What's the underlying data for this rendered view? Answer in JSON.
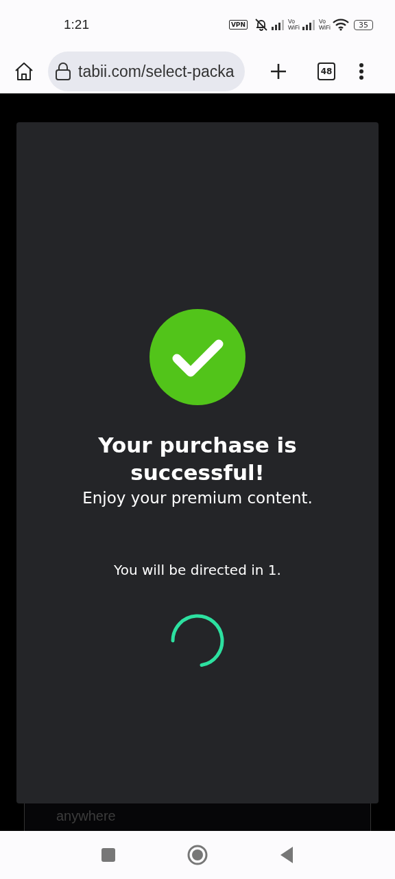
{
  "status_bar": {
    "time": "1:21",
    "vpn": "VPN",
    "vowifi": [
      "Vo\nWiFi",
      "Vo\nWiFi"
    ],
    "battery": "35"
  },
  "browser": {
    "url": "tabii.com/select-packa",
    "tab_count": "48"
  },
  "modal": {
    "title": "Your purchase is successful!",
    "subtitle": "Enjoy your premium content.",
    "redirect": "You will be directed in 1."
  },
  "background": {
    "feature_text": "anywhere"
  }
}
